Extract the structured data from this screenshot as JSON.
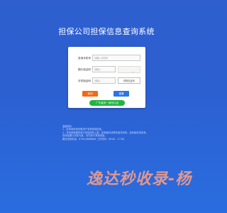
{
  "page": {
    "title": "担保公司担保信息查询系统"
  },
  "form": {
    "phone_label": "查询手机号",
    "phone_value": "请输入手机号",
    "captcha_label": "图片验证码",
    "captcha_placeholder": "请输入",
    "sms_label": "手机验证码",
    "sms_placeholder": "请输入",
    "sms_button": "获取验证码",
    "query_button": "查询",
    "reset_button": "重置",
    "guangdong_button": "广东省统一身份认证"
  },
  "notes": {
    "title": "温馨提示：",
    "lines": [
      "1、此查询系统仅限用于查询担保信息。",
      "2、本系统数据来源于担保机构上报，如有疑问请联系相关机构，该系统仅供参考。",
      "   查询结果以实际为准，请勿用于其他用途。",
      "服务咨询电话：0756-8888888  工作时间：09:00 - 17:00"
    ]
  },
  "watermark": {
    "text": "逸达秒收录-杨"
  }
}
